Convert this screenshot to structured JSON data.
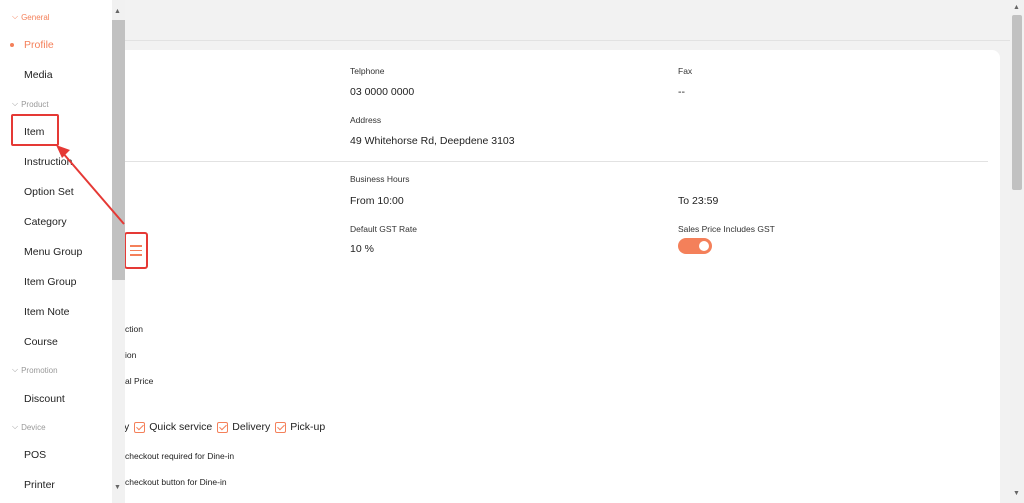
{
  "profile": {
    "telephone_label": "Telphone",
    "telephone_value": "03 0000 0000",
    "fax_label": "Fax",
    "fax_value": "--",
    "address_label": "Address",
    "address_value": "49 Whitehorse Rd, Deepdene 3103",
    "business_hours_label": "Business Hours",
    "hours_from": "From 10:00",
    "hours_to": "To 23:59",
    "gst_rate_label": "Default GST Rate",
    "gst_rate_value": "10 %",
    "sales_price_gst_label": "Sales Price Includes GST",
    "sales_price_gst_on": true
  },
  "options": {
    "partial_1": "ction",
    "partial_2": "ion",
    "partial_3": "al Price",
    "service_partial": "y",
    "quick_service": "Quick service",
    "delivery": "Delivery",
    "pickup": "Pick-up",
    "checkout_required": "checkout required for Dine-in",
    "checkout_button": "checkout button for Dine-in"
  },
  "sidebar": {
    "sections": [
      {
        "label": "General"
      },
      {
        "label": "Product"
      },
      {
        "label": "Promotion"
      },
      {
        "label": "Device"
      }
    ],
    "items": [
      {
        "label": "Profile"
      },
      {
        "label": "Media"
      },
      {
        "label": "Item"
      },
      {
        "label": "Instruction"
      },
      {
        "label": "Option Set"
      },
      {
        "label": "Category"
      },
      {
        "label": "Menu Group"
      },
      {
        "label": "Item Group"
      },
      {
        "label": "Item Note"
      },
      {
        "label": "Course"
      },
      {
        "label": "Discount"
      },
      {
        "label": "POS"
      },
      {
        "label": "Printer"
      }
    ]
  },
  "colors": {
    "accent": "#f4805a",
    "annotation": "#e53935"
  },
  "icons": {
    "chevron": "chevron-down-icon",
    "menu": "hamburger-menu-icon"
  }
}
